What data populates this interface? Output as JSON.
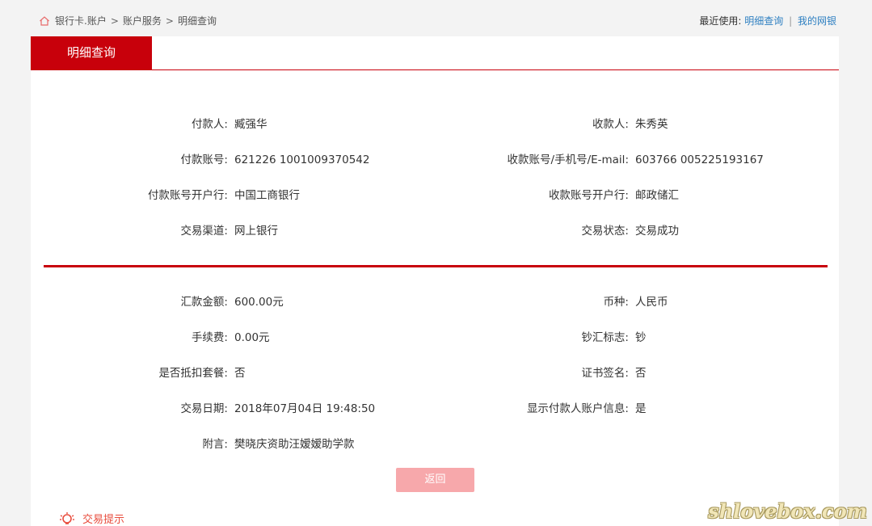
{
  "breadcrumb": {
    "items": [
      "银行卡.账户",
      "账户服务",
      "明细查询"
    ],
    "separator": ">"
  },
  "recent": {
    "label": "最近使用:",
    "links": [
      "明细查询",
      "我的网银"
    ],
    "divider": "|"
  },
  "tab": {
    "label": "明细查询"
  },
  "details_top": [
    {
      "left_label": "付款人:",
      "left_value": "臧强华",
      "right_label": "收款人:",
      "right_value": "朱秀英"
    },
    {
      "left_label": "付款账号:",
      "left_value": "621226 1001009370542",
      "right_label": "收款账号/手机号/E-mail:",
      "right_value": "603766 005225193167"
    },
    {
      "left_label": "付款账号开户行:",
      "left_value": "中国工商银行",
      "right_label": "收款账号开户行:",
      "right_value": "邮政储汇"
    },
    {
      "left_label": "交易渠道:",
      "left_value": "网上银行",
      "right_label": "交易状态:",
      "right_value": "交易成功"
    }
  ],
  "details_bottom": [
    {
      "left_label": "汇款金额:",
      "left_value": "600.00元",
      "right_label": "币种:",
      "right_value": "人民币"
    },
    {
      "left_label": "手续费:",
      "left_value": "0.00元",
      "right_label": "钞汇标志:",
      "right_value": "钞"
    },
    {
      "left_label": "是否抵扣套餐:",
      "left_value": "否",
      "right_label": "证书签名:",
      "right_value": "否"
    },
    {
      "left_label": "交易日期:",
      "left_value": "2018年07月04日 19:48:50",
      "right_label": "显示付款人账户信息:",
      "right_value": "是"
    },
    {
      "left_label": "附言:",
      "left_value": "樊晓庆资助汪嫒嫒助学款"
    }
  ],
  "buttons": {
    "back_label": "返回"
  },
  "tip": {
    "label": "交易提示"
  },
  "watermark": "shlovebox.com",
  "colors": {
    "accent": "#c8000b",
    "link": "#2d7fc1",
    "button_disabled": "#f7a8ab"
  },
  "icons": {
    "home": "home-icon",
    "tip": "lightbulb-icon"
  }
}
